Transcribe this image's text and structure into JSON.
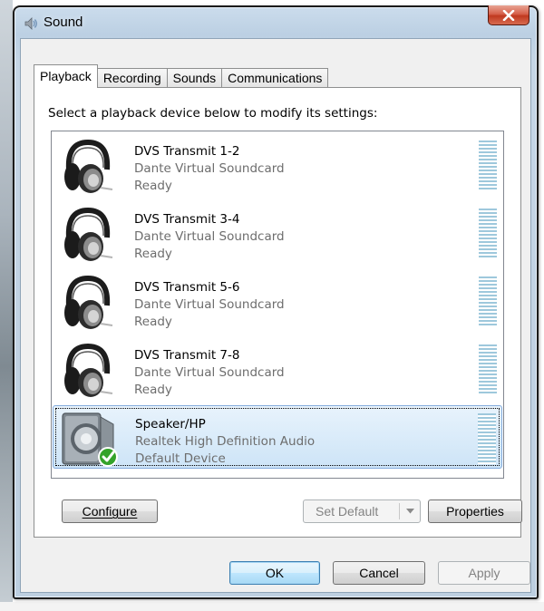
{
  "window": {
    "title": "Sound",
    "icon": "speaker-icon",
    "close_icon": "close-icon"
  },
  "tabs": [
    {
      "label": "Playback",
      "active": true
    },
    {
      "label": "Recording",
      "active": false
    },
    {
      "label": "Sounds",
      "active": false
    },
    {
      "label": "Communications",
      "active": false
    }
  ],
  "instruction": "Select a playback device below to modify its settings:",
  "devices": [
    {
      "name": "DVS Transmit 1-2",
      "driver": "Dante Virtual Soundcard",
      "status": "Ready",
      "icon": "headphones-icon",
      "selected": false
    },
    {
      "name": "DVS Transmit 3-4",
      "driver": "Dante Virtual Soundcard",
      "status": "Ready",
      "icon": "headphones-icon",
      "selected": false
    },
    {
      "name": "DVS Transmit 5-6",
      "driver": "Dante Virtual Soundcard",
      "status": "Ready",
      "icon": "headphones-icon",
      "selected": false
    },
    {
      "name": "DVS Transmit 7-8",
      "driver": "Dante Virtual Soundcard",
      "status": "Ready",
      "icon": "headphones-icon",
      "selected": false
    },
    {
      "name": "Speaker/HP",
      "driver": "Realtek High Definition Audio",
      "status": "Default Device",
      "icon": "speaker-icon",
      "selected": true,
      "badge_icon": "check-icon"
    }
  ],
  "buttons": {
    "configure": "Configure",
    "set_default": "Set Default",
    "properties": "Properties",
    "ok": "OK",
    "cancel": "Cancel",
    "apply": "Apply"
  },
  "colors": {
    "selection": "#cde4f7",
    "meter": "#9ec8dc",
    "close_button": "#c0391f",
    "check_badge": "#34a32a"
  }
}
